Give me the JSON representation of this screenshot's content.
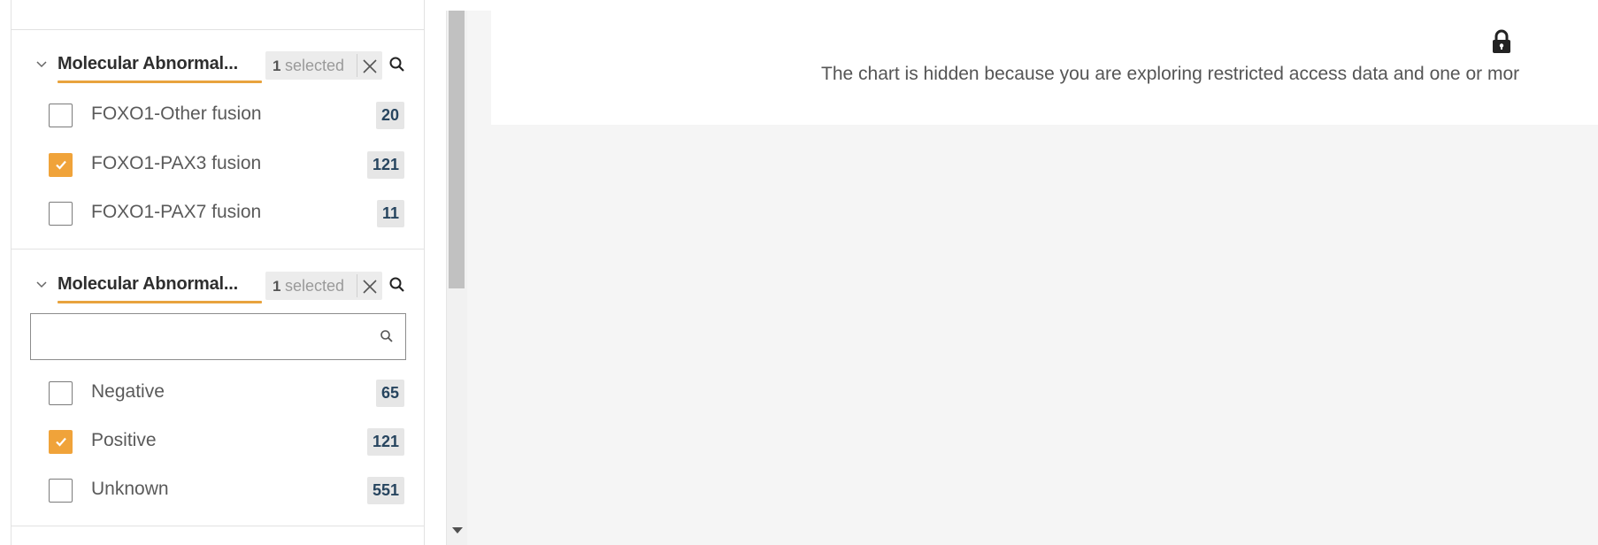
{
  "facets": [
    {
      "title": "Molecular Abnormal...",
      "selected_count": "1",
      "selected_word": "selected",
      "options": [
        {
          "label": "FOXO1-Other fusion",
          "count": "20",
          "checked": false
        },
        {
          "label": "FOXO1-PAX3 fusion",
          "count": "121",
          "checked": true
        },
        {
          "label": "FOXO1-PAX7 fusion",
          "count": "11",
          "checked": false
        }
      ]
    },
    {
      "title": "Molecular Abnormal...",
      "selected_count": "1",
      "selected_word": "selected",
      "search": {
        "value": "",
        "placeholder": ""
      },
      "options": [
        {
          "label": "Negative",
          "count": "65",
          "checked": false
        },
        {
          "label": "Positive",
          "count": "121",
          "checked": true
        },
        {
          "label": "Unknown",
          "count": "551",
          "checked": false
        }
      ]
    }
  ],
  "chart_panel": {
    "icon": "lock-icon",
    "message": "The chart is hidden because you are exploring restricted access data and one or mor"
  },
  "colors": {
    "accent": "#f0a33a",
    "underline": "#e8a33d",
    "count_text": "#27455f",
    "background": "#f5f5f5"
  }
}
